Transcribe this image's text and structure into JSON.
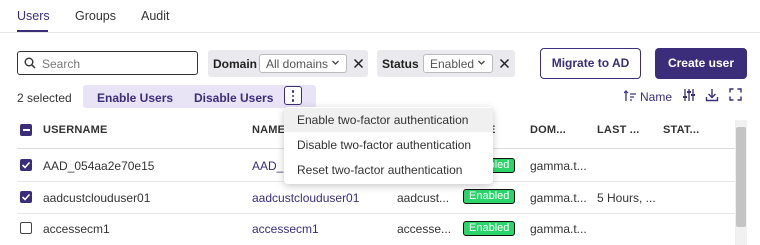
{
  "tabs": [
    {
      "label": "Users",
      "active": true
    },
    {
      "label": "Groups",
      "active": false
    },
    {
      "label": "Audit",
      "active": false
    }
  ],
  "search": {
    "placeholder": "Search",
    "value": ""
  },
  "filters": {
    "domain": {
      "label": "Domain",
      "selected": "All domains"
    },
    "status": {
      "label": "Status",
      "selected": "Enabled"
    }
  },
  "buttons": {
    "migrate": "Migrate to AD",
    "create": "Create user"
  },
  "selection": {
    "count_text": "2 selected",
    "enable": "Enable Users",
    "disable": "Disable Users"
  },
  "sort": {
    "label": "Name"
  },
  "table": {
    "columns": [
      "USERNAME",
      "NAME",
      "E",
      "DOM...",
      "LAST ...",
      "STAT..."
    ],
    "rows": [
      {
        "checked": true,
        "username": "AAD_054aa2e70e15",
        "name": "AAD_",
        "status": "Enabled",
        "domain": "gamma.t...",
        "last": "",
        "stat": ""
      },
      {
        "checked": true,
        "username": "aadcustclouduser01",
        "name": "aadcustclouduser01",
        "col3": "aadcust...",
        "status": "Enabled",
        "domain": "gamma.t...",
        "last": "5 Hours, ...",
        "stat": ""
      },
      {
        "checked": false,
        "username": "accessecm1",
        "name": "accessecm1",
        "col3": "accesse...",
        "status": "Enabled",
        "domain": "gamma.t...",
        "last": "",
        "stat": ""
      }
    ]
  },
  "menu": {
    "items": [
      "Enable two-factor authentication",
      "Disable two-factor authentication",
      "Reset two-factor authentication"
    ]
  },
  "colors": {
    "brand": "#3b2d7a",
    "badge": "#2bd56a",
    "selection_bg": "#e8e4f6"
  }
}
